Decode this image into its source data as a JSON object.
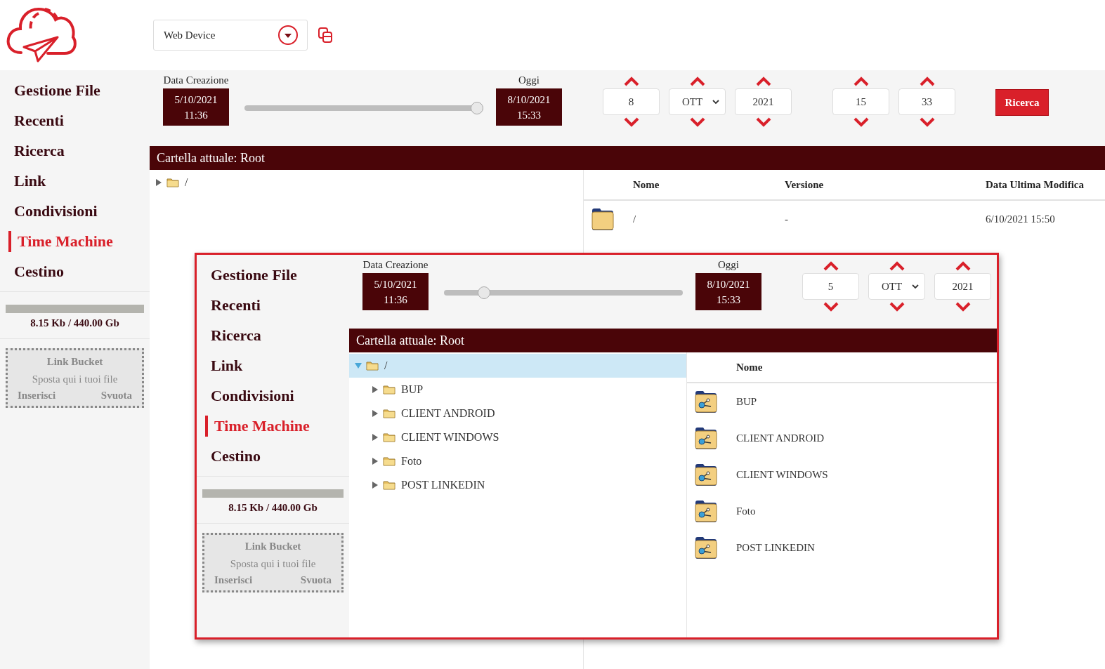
{
  "header": {
    "device_select": {
      "value": "Web Device"
    }
  },
  "main": {
    "sidebar": {
      "items": [
        {
          "label": "Gestione File",
          "selected": false
        },
        {
          "label": "Recenti",
          "selected": false
        },
        {
          "label": "Ricerca",
          "selected": false
        },
        {
          "label": "Link",
          "selected": false
        },
        {
          "label": "Condivisioni",
          "selected": false
        },
        {
          "label": "Time Machine",
          "selected": true
        },
        {
          "label": "Cestino",
          "selected": false
        }
      ]
    },
    "storage": {
      "level": 0,
      "text": "8.15 Kb / 440.00 Gb"
    },
    "bucket": {
      "title": "Link Bucket",
      "hint": "Sposta qui i tuoi file",
      "actions": [
        "Inserisci",
        "Svuota"
      ]
    },
    "date_filter": {
      "start": {
        "label": "Data Creazione",
        "date": "5/10/2021",
        "time": "11:36"
      },
      "slider": {
        "level": 1
      },
      "end": {
        "label": "Oggi",
        "date": "8/10/2021",
        "time": "15:33"
      },
      "date_fields": [
        {
          "kind": "number",
          "value": "8"
        },
        {
          "kind": "select",
          "value": "OTT"
        },
        {
          "kind": "number",
          "value": "2021"
        }
      ],
      "time_fields": [
        {
          "kind": "number",
          "value": "15"
        },
        {
          "kind": "number",
          "value": "33"
        }
      ],
      "search_button": "Ricerca"
    },
    "breadcrumb": "Cartella attuale: Root",
    "tree": [
      {
        "label": "/",
        "expanded": false,
        "selected": false
      }
    ],
    "table": {
      "columns": [
        "Nome",
        "Versione",
        "Data Ultima Modifica"
      ],
      "rows": [
        {
          "kind": "folder",
          "cells": [
            "/",
            "-",
            "6/10/2021 15:50"
          ]
        }
      ]
    }
  },
  "inset": {
    "sidebar": {
      "items": [
        {
          "label": "Gestione File",
          "selected": false
        },
        {
          "label": "Recenti",
          "selected": false
        },
        {
          "label": "Ricerca",
          "selected": false
        },
        {
          "label": "Link",
          "selected": false
        },
        {
          "label": "Condivisioni",
          "selected": false
        },
        {
          "label": "Time Machine",
          "selected": true
        },
        {
          "label": "Cestino",
          "selected": false
        }
      ]
    },
    "storage": {
      "level": 0,
      "text": "8.15 Kb / 440.00 Gb"
    },
    "bucket": {
      "title": "Link Bucket",
      "hint": "Sposta qui i tuoi file",
      "actions": [
        "Inserisci",
        "Svuota"
      ]
    },
    "date_filter": {
      "start": {
        "label": "Data Creazione",
        "date": "5/10/2021",
        "time": "11:36"
      },
      "slider": {
        "level": 0.15
      },
      "end": {
        "label": "Oggi",
        "date": "8/10/2021",
        "time": "15:33"
      },
      "date_fields": [
        {
          "kind": "number",
          "value": "5"
        },
        {
          "kind": "select",
          "value": "OTT"
        },
        {
          "kind": "number",
          "value": "2021"
        }
      ]
    },
    "breadcrumb": "Cartella attuale: Root",
    "tree": [
      {
        "label": "/",
        "expanded": true,
        "selected": true,
        "children": [
          {
            "label": "BUP",
            "expanded": false,
            "selected": false
          },
          {
            "label": "CLIENT ANDROID",
            "expanded": false,
            "selected": false
          },
          {
            "label": "CLIENT WINDOWS",
            "expanded": false,
            "selected": false
          },
          {
            "label": "Foto",
            "expanded": false,
            "selected": false
          },
          {
            "label": "POST LINKEDIN",
            "expanded": false,
            "selected": false
          }
        ]
      }
    ],
    "table": {
      "columns": [
        "Nome"
      ],
      "rows": [
        {
          "kind": "shared-folder",
          "cells": [
            "BUP"
          ]
        },
        {
          "kind": "shared-folder",
          "cells": [
            "CLIENT ANDROID"
          ]
        },
        {
          "kind": "shared-folder",
          "cells": [
            "CLIENT WINDOWS"
          ]
        },
        {
          "kind": "shared-folder",
          "cells": [
            "Foto"
          ]
        },
        {
          "kind": "shared-folder",
          "cells": [
            "POST LINKEDIN"
          ]
        }
      ]
    }
  }
}
